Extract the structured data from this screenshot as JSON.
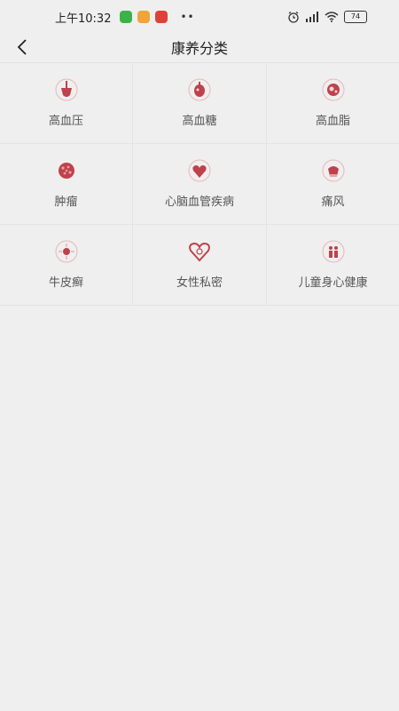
{
  "status_bar": {
    "time": "上午10:32",
    "battery": "74"
  },
  "header": {
    "title": "康养分类"
  },
  "categories": [
    {
      "label": "高血压",
      "icon": "blood-pressure-icon"
    },
    {
      "label": "高血糖",
      "icon": "blood-sugar-icon"
    },
    {
      "label": "高血脂",
      "icon": "blood-lipid-icon"
    },
    {
      "label": "肿瘤",
      "icon": "tumor-icon"
    },
    {
      "label": "心脑血管疾病",
      "icon": "cardio-cerebrovascular-icon"
    },
    {
      "label": "痛风",
      "icon": "gout-icon"
    },
    {
      "label": "牛皮癣",
      "icon": "psoriasis-icon"
    },
    {
      "label": "女性私密",
      "icon": "female-health-icon"
    },
    {
      "label": "儿童身心健康",
      "icon": "child-health-icon"
    }
  ],
  "colors": {
    "accent": "#c0414b",
    "background": "#efefef"
  }
}
